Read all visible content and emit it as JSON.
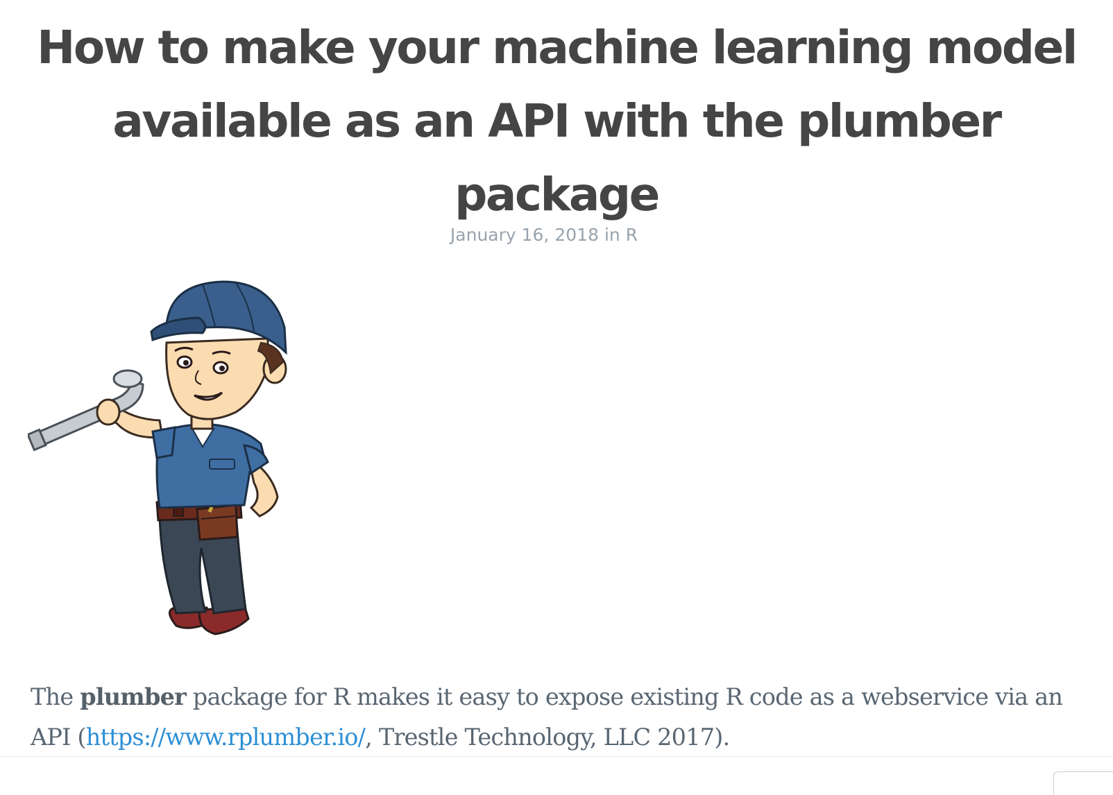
{
  "article": {
    "title": "How to make your machine learning model available as an API with the plumber package",
    "date": "January 16, 2018",
    "in_word": "in",
    "category": "R",
    "intro": {
      "part1": "The ",
      "bold": "plumber",
      "part2": " package for R makes it easy to expose existing R code as a webservice via an API (",
      "link_text": "https://www.rplumber.io/",
      "part3": ", Trestle Technology, LLC 2017)."
    }
  },
  "colors": {
    "title": "#454545",
    "meta": "#99a3ad",
    "body_text": "#596672",
    "link": "#2d8fd5"
  },
  "icons": {
    "illustration": "plumber-mascot-illustration"
  }
}
